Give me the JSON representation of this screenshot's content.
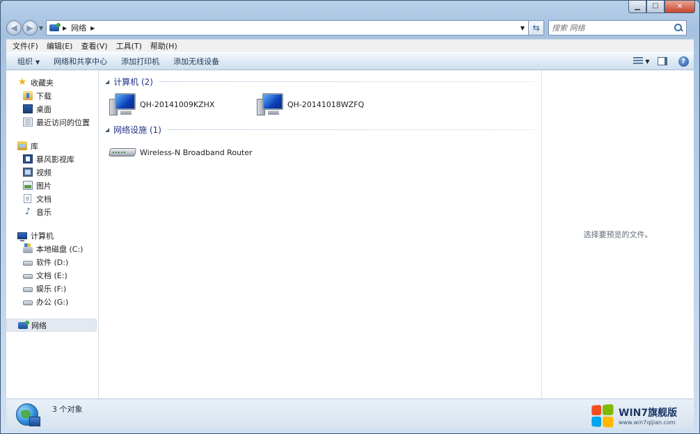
{
  "window": {
    "minimize": "▁",
    "maximize": "☐",
    "close": "✕"
  },
  "address": {
    "crumbs": [
      "网络"
    ],
    "search_placeholder": "搜索 网络"
  },
  "menubar": {
    "items": [
      "文件(F)",
      "编辑(E)",
      "查看(V)",
      "工具(T)",
      "帮助(H)"
    ]
  },
  "commandbar": {
    "organize": "组织",
    "network_center": "网络和共享中心",
    "add_printer": "添加打印机",
    "add_wireless": "添加无线设备"
  },
  "nav": {
    "favorites": {
      "label": "收藏夹",
      "items": [
        "下载",
        "桌面",
        "最近访问的位置"
      ]
    },
    "libraries": {
      "label": "库",
      "items": [
        "暴风影视库",
        "视频",
        "图片",
        "文档",
        "音乐"
      ]
    },
    "computer": {
      "label": "计算机",
      "items": [
        "本地磁盘 (C:)",
        "软件 (D:)",
        "文档 (E:)",
        "娱乐 (F:)",
        "办公 (G:)"
      ]
    },
    "network": {
      "label": "网络"
    }
  },
  "main": {
    "groups": [
      {
        "header": "计算机 (2)",
        "items": [
          "QH-20141009KZHX",
          "QH-20141018WZFQ"
        ]
      },
      {
        "header": "网络设施 (1)",
        "items": [
          "Wireless-N Broadband Router"
        ]
      }
    ]
  },
  "preview": {
    "message": "选择要预览的文件。"
  },
  "status": {
    "text": "3 个对象"
  },
  "watermark": {
    "title": "WIN7旗舰版",
    "url": "www.win7qijian.com"
  }
}
